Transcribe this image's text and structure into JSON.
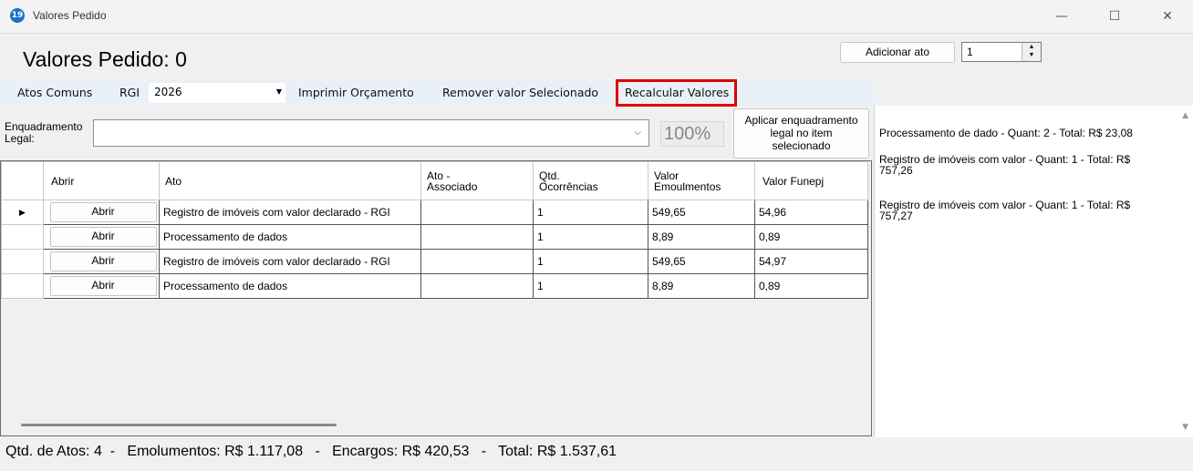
{
  "window": {
    "title": "Valores Pedido",
    "app_icon": "19",
    "minimize": "—",
    "maximize": "☐",
    "close": "✕"
  },
  "form": {
    "title": "Valores Pedido: 0"
  },
  "top": {
    "add_button": "Adicionar ato",
    "quantity": "1"
  },
  "toolbar": {
    "atos_comuns": "Atos Comuns",
    "rgi_label": "RGI",
    "rgi_value": "2026",
    "imprimir": "Imprimir Orçamento",
    "remover": "Remover valor Selecionado",
    "recalcular": "Recalcular Valores"
  },
  "enquadramento": {
    "label_line1": "Enquadramento",
    "label_line2": "Legal:",
    "value": "",
    "percent": "100%",
    "apply_line1": "Aplicar enquadramento",
    "apply_line2": "legal no item",
    "apply_line3": "selecionado"
  },
  "grid": {
    "headers": {
      "abrir": "Abrir",
      "ato": "Ato",
      "ato_associado_1": "Ato -",
      "ato_associado_2": "Associado",
      "qtd_1": "Qtd.",
      "qtd_2": "Ocorrências",
      "valor_emol_1": "Valor",
      "valor_emol_2": "Emoulmentos",
      "valor_funepj": "Valor Funepj"
    },
    "rows": [
      {
        "abrir": "Abrir",
        "ato": "Registro de imóveis com valor declarado - RGI",
        "associado": "",
        "qtd": "1",
        "emolumentos": "549,65",
        "funepj": "54,96"
      },
      {
        "abrir": "Abrir",
        "ato": "Processamento de dados",
        "associado": "",
        "qtd": "1",
        "emolumentos": "8,89",
        "funepj": "0,89"
      },
      {
        "abrir": "Abrir",
        "ato": "Registro de imóveis com valor declarado - RGI",
        "associado": "",
        "qtd": "1",
        "emolumentos": "549,65",
        "funepj": "54,97"
      },
      {
        "abrir": "Abrir",
        "ato": "Processamento de dados",
        "associado": "",
        "qtd": "1",
        "emolumentos": "8,89",
        "funepj": "0,89"
      }
    ],
    "selected_marker": "▶"
  },
  "summary": [
    {
      "line1": "Processamento de dado  -  Quant: 2 - Total: R$ 23,08",
      "line2": ""
    },
    {
      "line1": "Registro de imóveis com valor  -  Quant: 1 - Total: R$",
      "line2": "757,26"
    },
    {
      "line1": "Registro de imóveis com valor  -  Quant: 1 - Total: R$",
      "line2": "757,27"
    }
  ],
  "status": "Qtd. de Atos: 4  -   Emolumentos: R$ 1.117,08   -   Encargos: R$ 420,53   -   Total: R$ 1.537,61"
}
